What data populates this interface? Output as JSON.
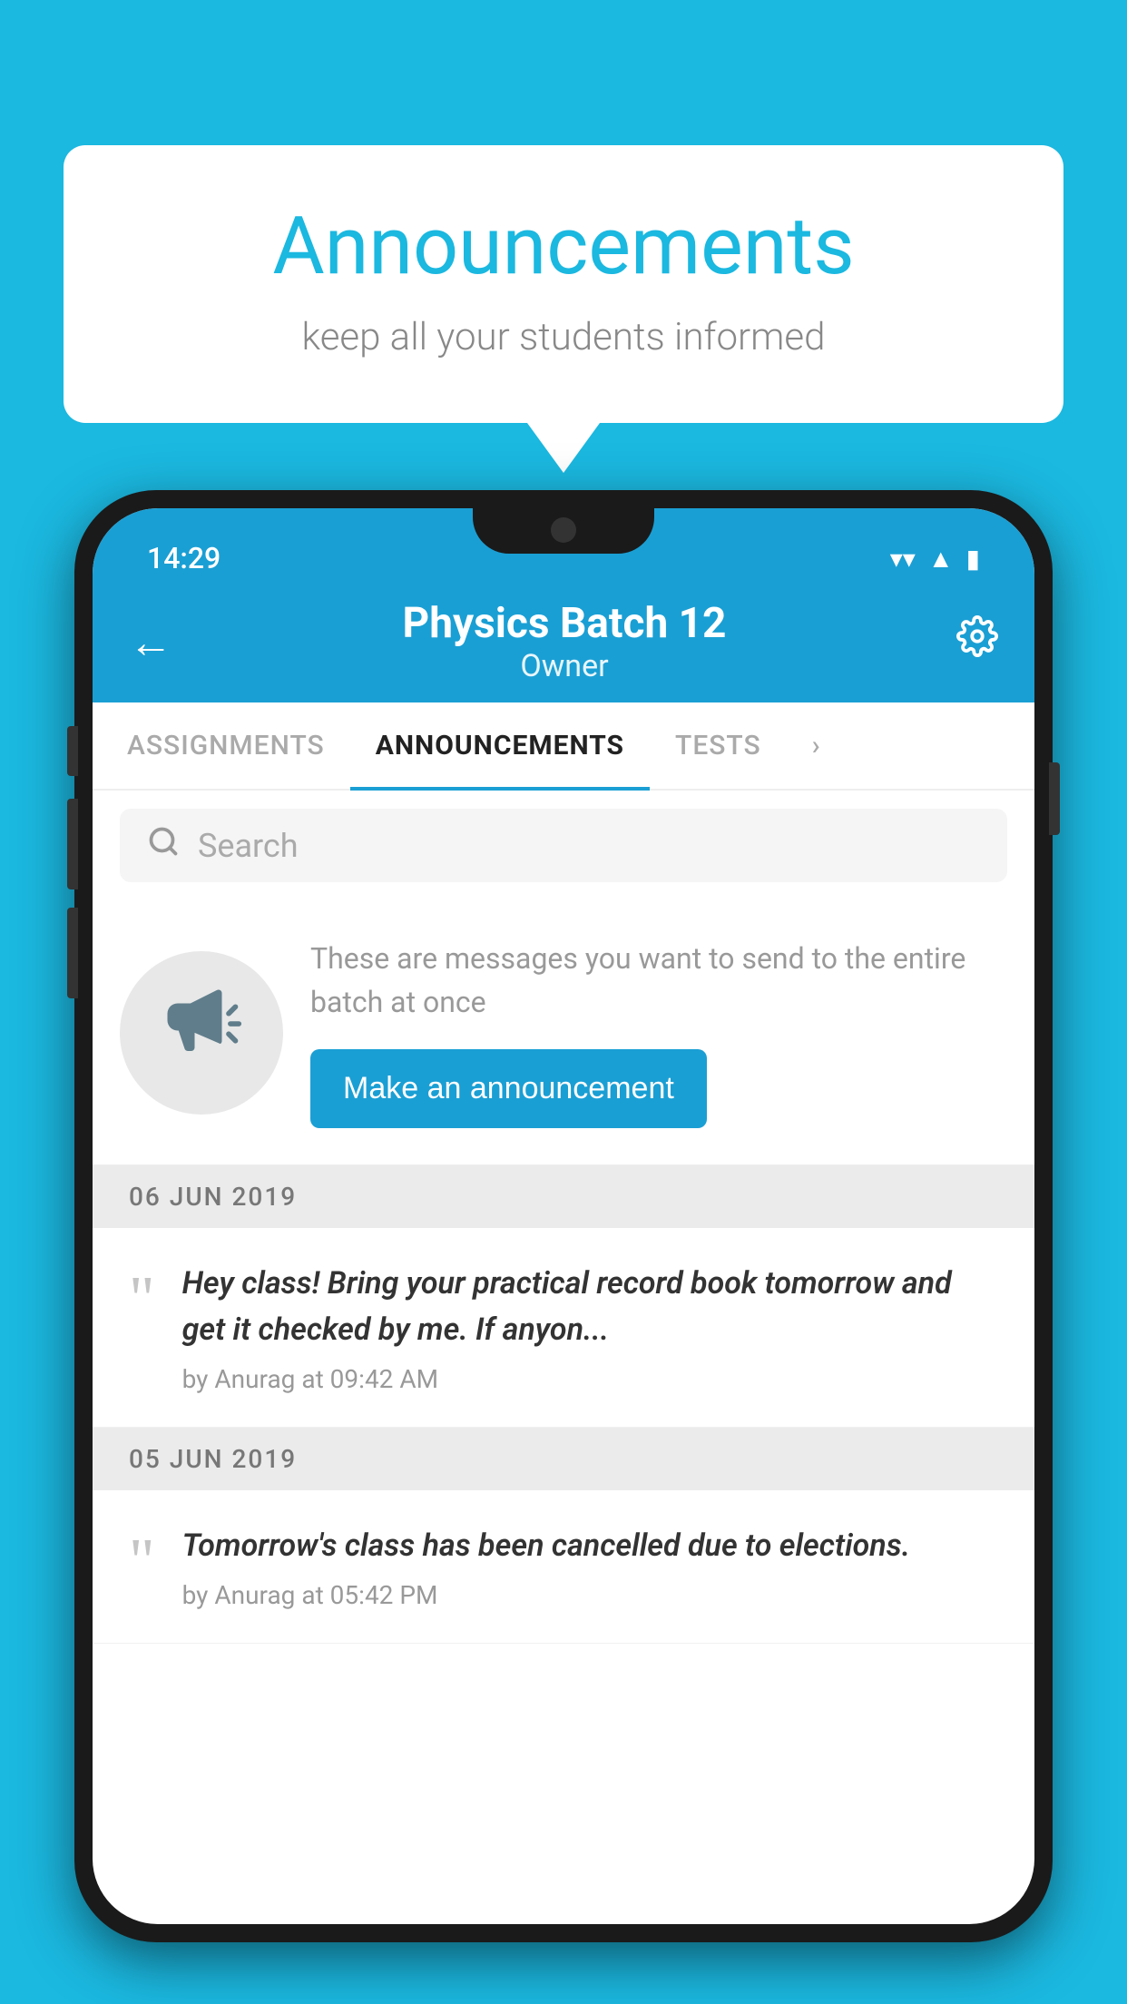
{
  "page": {
    "background_color": "#1BB8E0"
  },
  "speech_bubble": {
    "title": "Announcements",
    "subtitle": "keep all your students informed",
    "title_color": "#1BB8E0"
  },
  "phone": {
    "status_bar": {
      "time": "14:29",
      "wifi": "▼",
      "signal": "▲",
      "battery": "▮"
    },
    "header": {
      "title": "Physics Batch 12",
      "subtitle": "Owner",
      "back_label": "←",
      "settings_label": "⚙"
    },
    "tabs": [
      {
        "label": "ASSIGNMENTS",
        "active": false
      },
      {
        "label": "ANNOUNCEMENTS",
        "active": true
      },
      {
        "label": "TESTS",
        "active": false
      },
      {
        "label": "...",
        "active": false
      }
    ],
    "search": {
      "placeholder": "Search"
    },
    "announcement_cta": {
      "description": "These are messages you want to send to the entire batch at once",
      "button_label": "Make an announcement"
    },
    "announcements": [
      {
        "date": "06  JUN  2019",
        "text": "Hey class! Bring your practical record book tomorrow and get it checked by me. If anyon...",
        "meta": "by Anurag at 09:42 AM"
      },
      {
        "date": "05  JUN  2019",
        "text": "Tomorrow's class has been cancelled due to elections.",
        "meta": "by Anurag at 05:42 PM"
      }
    ]
  }
}
